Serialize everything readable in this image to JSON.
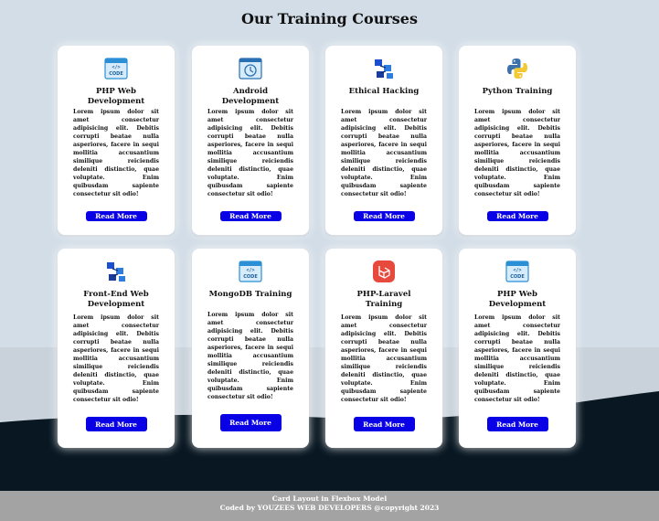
{
  "page": {
    "title": "Our Training Courses"
  },
  "read_more_label": "Read More",
  "lorem": "Lorem ipsum dolor sit amet consectetur adipisicing elit. Debitis corrupti beatae nulla asperiores, facere in sequi mollitia accusantium similique reiciendis deleniti distinctio, quae voluptate. Enim quibusdam sapiente consectetur sit odio!",
  "cards": [
    {
      "title": "PHP Web Development",
      "icon": "code-window-icon"
    },
    {
      "title": "Android Development",
      "icon": "mobile-app-icon"
    },
    {
      "title": "Ethical Hacking",
      "icon": "network-cubes-icon"
    },
    {
      "title": "Python Training",
      "icon": "python-logo-icon"
    },
    {
      "title": "Front-End Web Development",
      "icon": "network-cubes-icon"
    },
    {
      "title": "MongoDB Training",
      "icon": "code-window-icon"
    },
    {
      "title": "PHP-Laravel Training",
      "icon": "laravel-logo-icon"
    },
    {
      "title": "PHP Web Development",
      "icon": "code-window-icon"
    }
  ],
  "footer": {
    "line1": "Card Layout in Flexbox Model",
    "line2": "Coded by YOUZEES WEB DEVELOPERS @copyright 2023"
  },
  "colors": {
    "button": "#0a00e6",
    "background": "#d3dde7",
    "footer": "#a3a3a3",
    "hill": "#081722"
  }
}
